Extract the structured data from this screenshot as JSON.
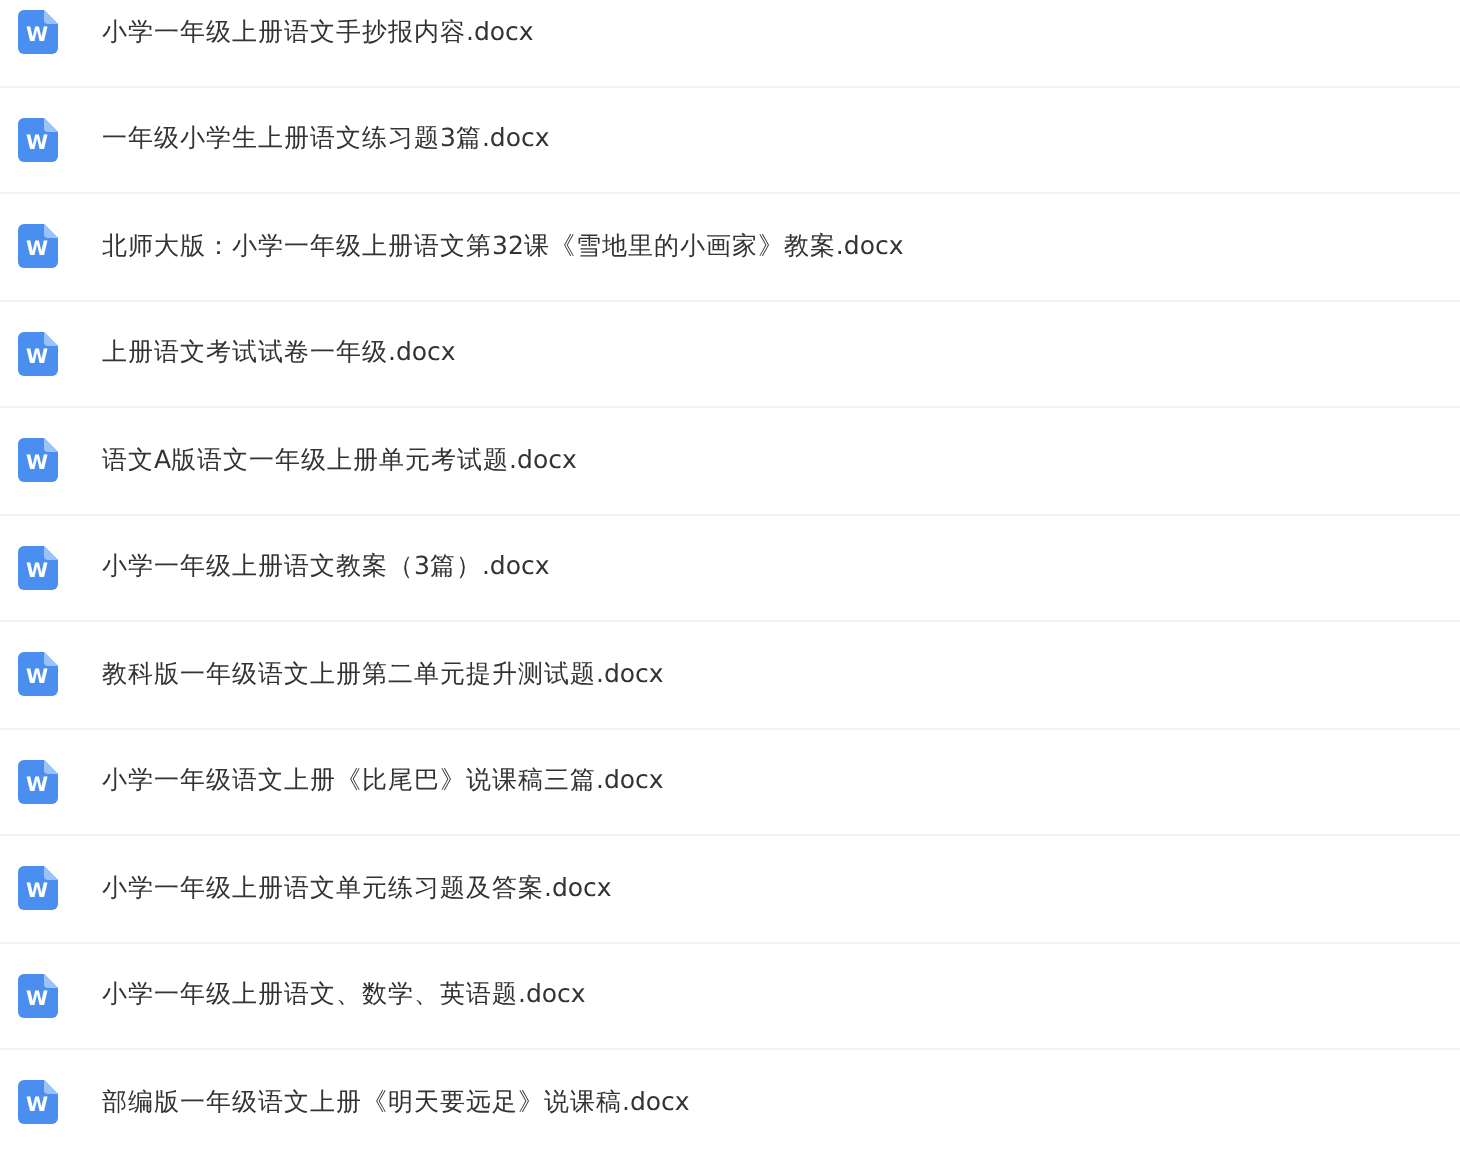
{
  "files": [
    {
      "name": "小学一年级上册语文手抄报内容.docx",
      "icon_label": "W"
    },
    {
      "name": "一年级小学生上册语文练习题3篇.docx",
      "icon_label": "W"
    },
    {
      "name": "北师大版：小学一年级上册语文第32课《雪地里的小画家》教案.docx",
      "icon_label": "W"
    },
    {
      "name": "上册语文考试试卷一年级.docx",
      "icon_label": "W"
    },
    {
      "name": "语文A版语文一年级上册单元考试题.docx",
      "icon_label": "W"
    },
    {
      "name": "小学一年级上册语文教案（3篇）.docx",
      "icon_label": "W"
    },
    {
      "name": "教科版一年级语文上册第二单元提升测试题.docx",
      "icon_label": "W"
    },
    {
      "name": "小学一年级语文上册《比尾巴》说课稿三篇.docx",
      "icon_label": "W"
    },
    {
      "name": "小学一年级上册语文单元练习题及答案.docx",
      "icon_label": "W"
    },
    {
      "name": "小学一年级上册语文、数学、英语题.docx",
      "icon_label": "W"
    },
    {
      "name": "部编版一年级语文上册《明天要远足》说课稿.docx",
      "icon_label": "W"
    }
  ]
}
